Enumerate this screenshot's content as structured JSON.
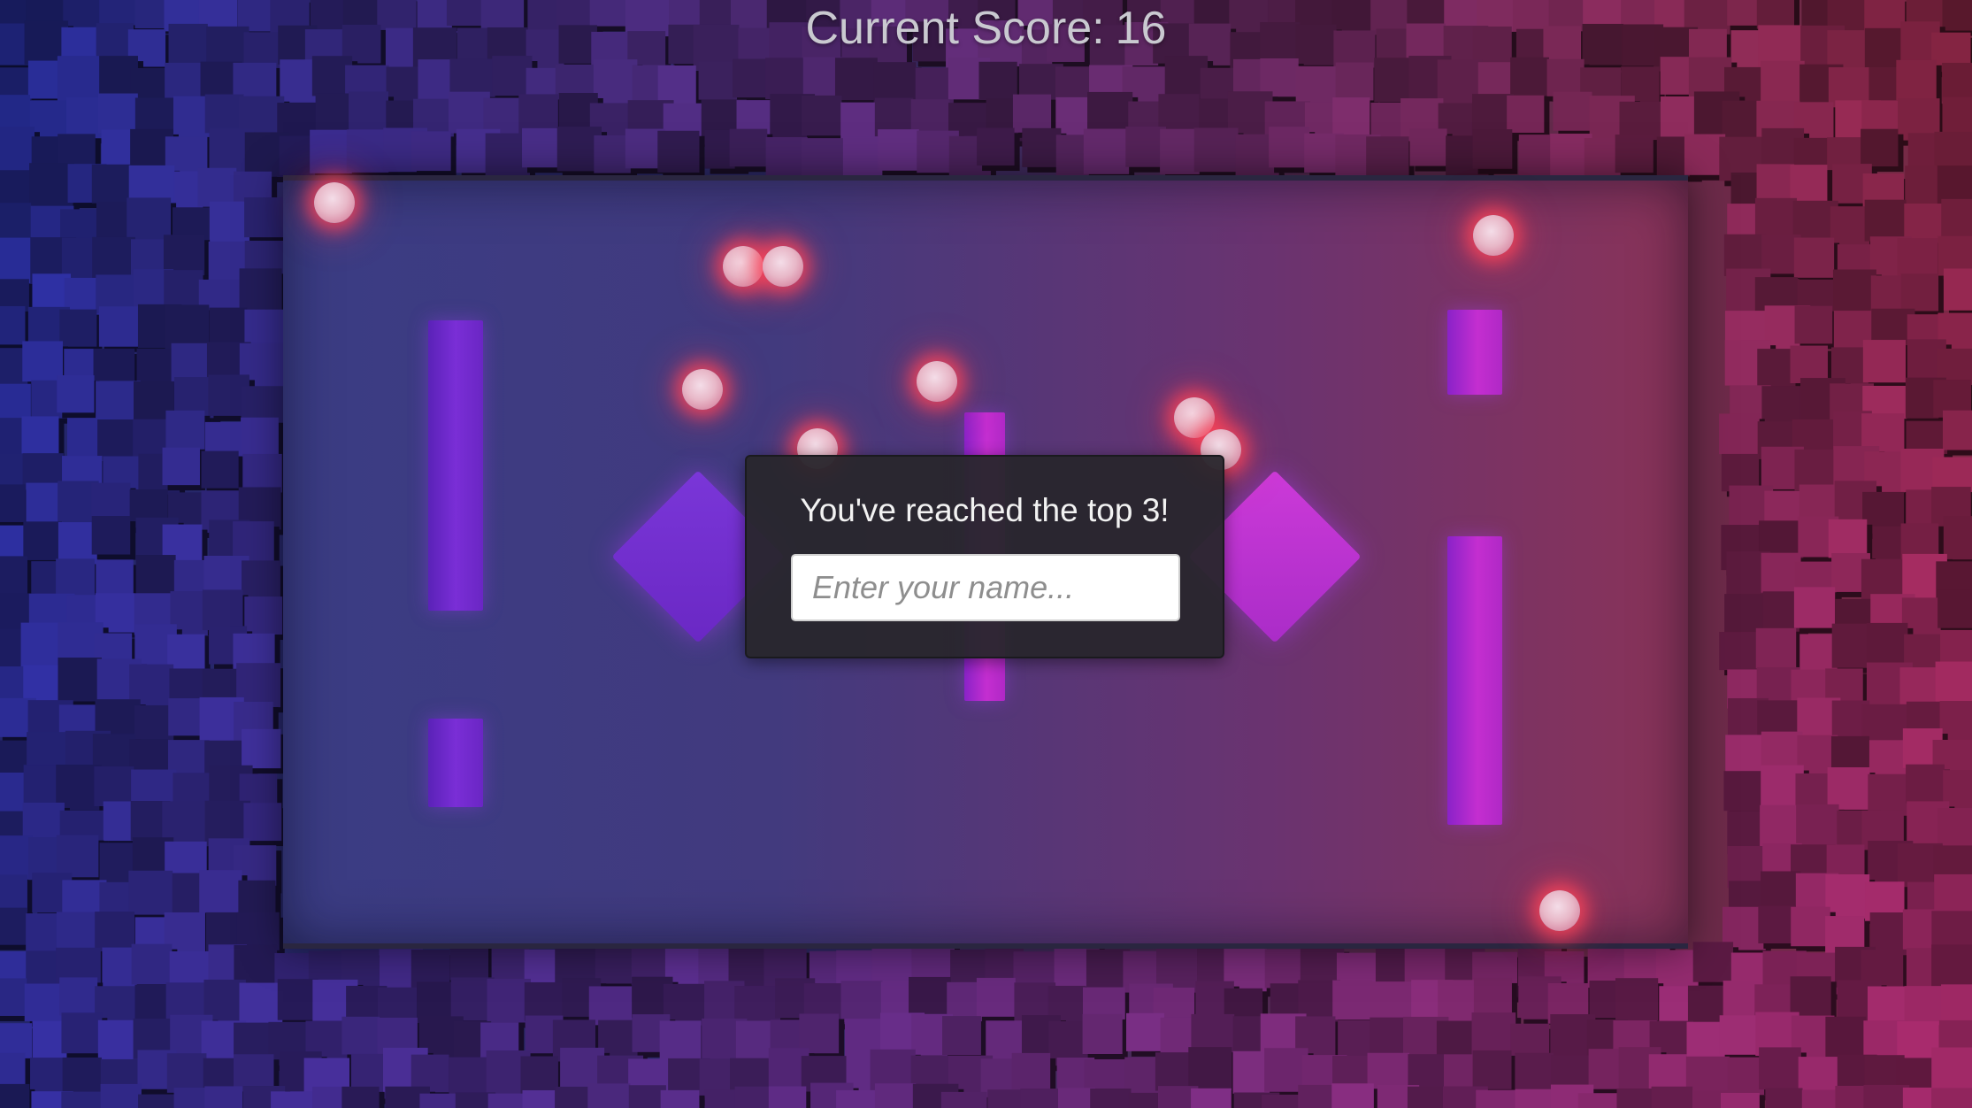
{
  "hud": {
    "score_label": "Current Score:",
    "score_value": "16"
  },
  "dialog": {
    "title": "You've reached the top 3!",
    "name_input_placeholder": "Enter your name...",
    "name_input_value": ""
  },
  "scene": {
    "orb_count": 13,
    "colors": {
      "left_wall": "#23266a",
      "right_wall": "#7a2a45",
      "violet_obstacle": "#6a26c4",
      "magenta_obstacle": "#c42ed0",
      "orb_glow": "#ff4658",
      "dialog_background": "#28262c"
    }
  }
}
